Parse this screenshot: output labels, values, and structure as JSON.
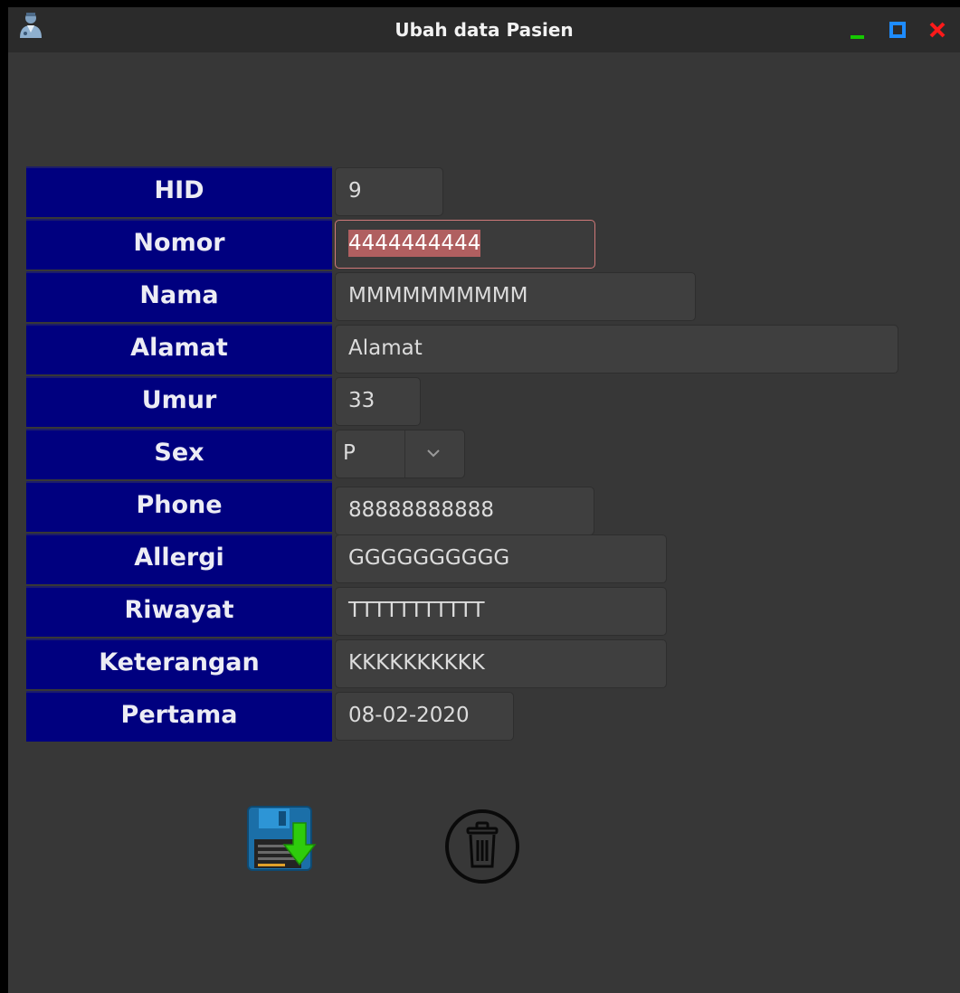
{
  "window": {
    "title": "Ubah data Pasien",
    "controls": {
      "minimize_color": "#15c800",
      "maximize_color": "#1e8cff",
      "close_color": "#ff1a1a"
    }
  },
  "form": {
    "label_bg": "#00007f",
    "fields": {
      "hid": {
        "label": "HID",
        "value": "9"
      },
      "nomor": {
        "label": "Nomor",
        "value": "4444444444"
      },
      "nama": {
        "label": "Nama",
        "value": "MMMMMMMMMM"
      },
      "alamat": {
        "label": "Alamat",
        "value": "Alamat"
      },
      "umur": {
        "label": "Umur",
        "value": "33"
      },
      "sex": {
        "label": "Sex",
        "value": "P"
      },
      "phone": {
        "label": "Phone",
        "value": "88888888888"
      },
      "allergi": {
        "label": "Allergi",
        "value": "GGGGGGGGGG"
      },
      "riwayat": {
        "label": "Riwayat",
        "value": "TTTTTTTTTTT"
      },
      "keterangan": {
        "label": "Keterangan",
        "value": "KKKKKKKKKK"
      },
      "pertama": {
        "label": "Pertama",
        "value": "08-02-2020"
      }
    }
  },
  "actions": {
    "save_icon": "floppy-save-icon",
    "delete_icon": "trash-icon"
  }
}
